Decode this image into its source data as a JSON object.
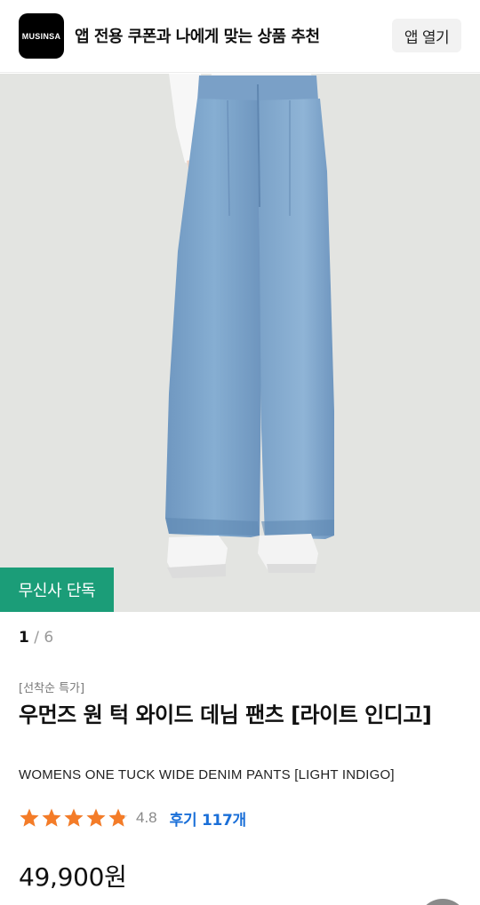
{
  "banner": {
    "logo_text": "MUSINSA",
    "message": "앱 전용 쿠폰과 나에게 맞는 상품 추천",
    "open_app_label": "앱 열기"
  },
  "gallery": {
    "badge": "무신사 단독",
    "current": "1",
    "separator": "/",
    "total": "6"
  },
  "product": {
    "promo_tag": "[선착순 특가]",
    "title": "우먼즈 원 턱 와이드 데님 팬츠 [라이트 인디고]",
    "english_title": "WOMENS ONE TUCK WIDE DENIM PANTS [LIGHT INDIGO]",
    "rating": 4.8,
    "rating_text": "4.8",
    "reviews_label": "후기 117개",
    "price": "49,900원"
  },
  "colors": {
    "badge_green": "#1b9d78",
    "star_orange": "#f47c28",
    "review_blue": "#1a6fd8"
  }
}
